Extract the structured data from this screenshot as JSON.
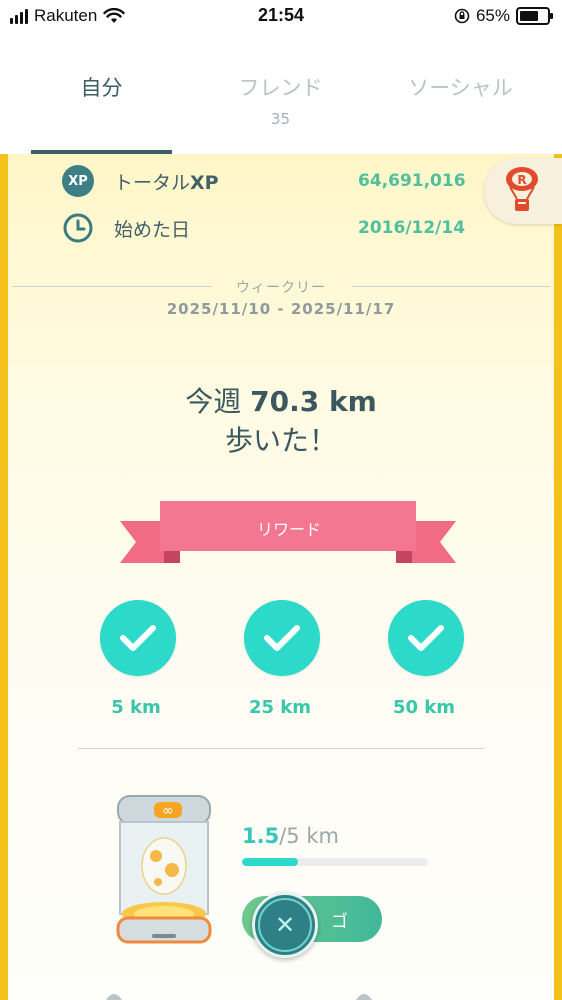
{
  "status_bar": {
    "carrier": "Rakuten",
    "time": "21:54",
    "battery_percent": "65%"
  },
  "tabs": [
    {
      "label": "自分",
      "active": true
    },
    {
      "label": "フレンド",
      "count": "35",
      "active": false
    },
    {
      "label": "ソーシャル",
      "active": false
    }
  ],
  "stats": {
    "xp_badge": "XP",
    "total_xp_label_prefix": "トータル",
    "total_xp_label_suffix": "XP",
    "total_xp_value": "64,691,016",
    "start_date_label": "始めた日",
    "start_date_value": "2016/12/14"
  },
  "weekly": {
    "label": "ウィークリー",
    "date_range": "2025/11/10 - 2025/11/17",
    "walked_prefix": "今週",
    "walked_distance": "70.3 km",
    "walked_suffix": "歩いた！"
  },
  "rewards": {
    "title": "リワード",
    "milestones": [
      {
        "label": "5 km",
        "completed": true
      },
      {
        "label": "25 km",
        "completed": true
      },
      {
        "label": "50 km",
        "completed": true
      }
    ]
  },
  "incubator": {
    "progress_current": "1.5",
    "progress_total": "/5 km",
    "progress_fraction": 0.3,
    "button_label": "ゴ"
  },
  "colors": {
    "accent_teal": "#2dd9c9",
    "green_value": "#4fbf9d",
    "ribbon_pink": "#f16b85",
    "side_border_yellow": "#f3c11a",
    "dark_teal": "#3a5f67"
  },
  "icons": {
    "signal": "signal-icon",
    "wifi": "wifi-icon",
    "orientation_lock": "orientation-lock-icon",
    "battery": "battery-icon",
    "clock": "clock-icon",
    "balloon": "team-rocket-balloon-icon",
    "check": "check-icon",
    "close": "close-icon"
  }
}
